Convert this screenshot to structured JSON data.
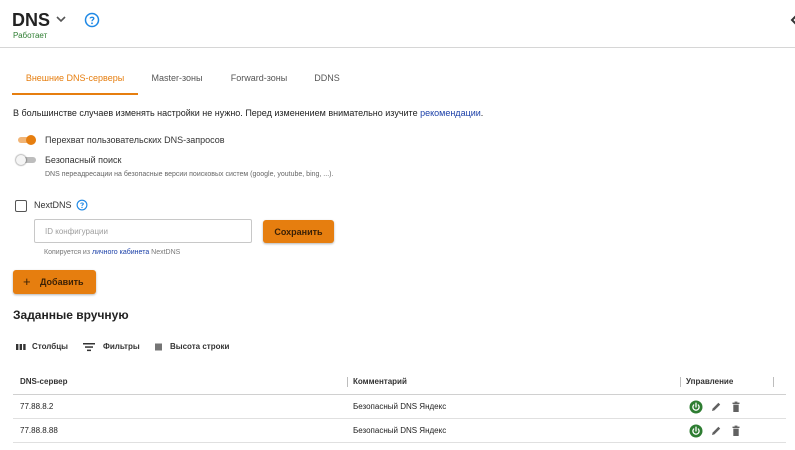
{
  "header": {
    "title": "DNS",
    "status": "Работает"
  },
  "colors": {
    "accent": "#e67e0f",
    "status_green": "#2e7d32",
    "link": "#1a3fa8"
  },
  "tabs": [
    {
      "label": "Внешние DNS-серверы",
      "active": true
    },
    {
      "label": "Master-зоны",
      "active": false
    },
    {
      "label": "Forward-зоны",
      "active": false
    },
    {
      "label": "DDNS",
      "active": false
    }
  ],
  "info": {
    "text": "В большинстве случаев изменять настройки не нужно. Перед изменением внимательно изучите ",
    "link": "рекомендации",
    "suffix": "."
  },
  "options": {
    "intercept": {
      "label": "Перехват пользовательских DNS-запросов",
      "enabled": true
    },
    "safe_search": {
      "label": "Безопасный поиск",
      "enabled": false,
      "description": "DNS переадресации на безопасные версии поисковых систем (google, youtube, bing, ...)."
    }
  },
  "nextdns": {
    "label": "NextDNS",
    "checked": false,
    "input_placeholder": "ID конфигурации",
    "input_value": "",
    "save_label": "Сохранить",
    "hint_prefix": "Копируется из ",
    "hint_link": "личного кабинета",
    "hint_suffix": " NextDNS"
  },
  "add_label": "Добавить",
  "section_title": "Заданные вручную",
  "toolbar": {
    "columns": "Столбцы",
    "filters": "Фильтры",
    "density": "Высота строки"
  },
  "table": {
    "columns": [
      "DNS-сервер",
      "Комментарий",
      "Управление"
    ],
    "rows": [
      {
        "server": "77.88.8.2",
        "comment": "Безопасный DNS Яндекс",
        "enabled": true
      },
      {
        "server": "77.88.8.88",
        "comment": "Безопасный DNS Яндекс",
        "enabled": true
      }
    ]
  },
  "icons": {
    "title_dropdown": "chevron-down-icon",
    "help": "help-circle-icon",
    "columns": "view-column-icon",
    "filters": "filter-list-icon",
    "density": "density-icon",
    "row_toggle": "power-icon",
    "row_edit": "pencil-icon",
    "row_delete": "trash-icon"
  }
}
